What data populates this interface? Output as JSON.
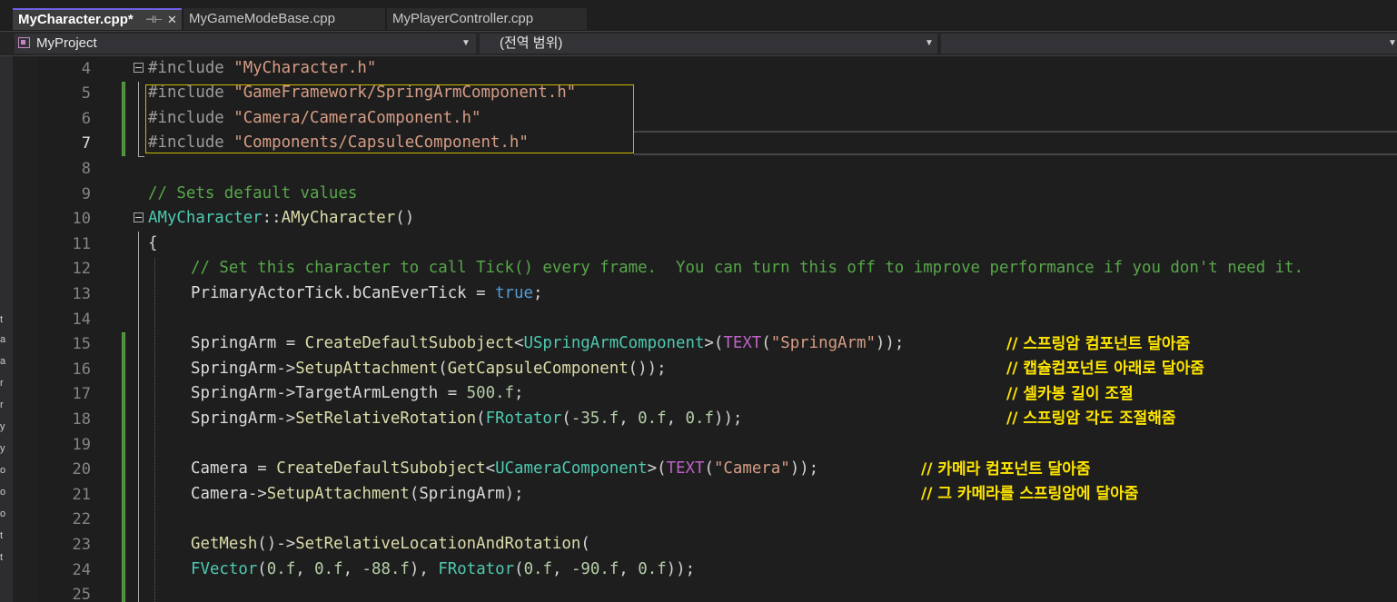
{
  "tabs": [
    {
      "label": "MyCharacter.cpp*",
      "active": true
    },
    {
      "label": "MyGameModeBase.cpp",
      "active": false
    },
    {
      "label": "MyPlayerController.cpp",
      "active": false
    }
  ],
  "nav": {
    "project": "MyProject",
    "scope": "(전역 범위)",
    "member": ""
  },
  "icons": {
    "pin": "pin-icon",
    "close": "close-icon",
    "dropdown": "chevron-down-icon",
    "fold": "collapse-icon"
  },
  "colors": {
    "active_tab_accent": "#7160e8",
    "annotation_yellow": "#ffe500",
    "change_bar_green": "#4a8a3a"
  },
  "line_numbers": [
    "4",
    "5",
    "6",
    "7",
    "8",
    "9",
    "10",
    "11",
    "12",
    "13",
    "14",
    "15",
    "16",
    "17",
    "18",
    "19",
    "20",
    "21",
    "22",
    "23",
    "24",
    "25"
  ],
  "current_line": "7",
  "code": {
    "l4": {
      "pp": "#include ",
      "str": "\"MyCharacter.h\""
    },
    "l5": {
      "pp": "#include ",
      "str": "\"GameFramework/SpringArmComponent.h\""
    },
    "l6": {
      "pp": "#include ",
      "str": "\"Camera/CameraComponent.h\""
    },
    "l7": {
      "pp": "#include ",
      "str": "\"Components/CapsuleComponent.h\""
    },
    "l9": {
      "cm": "// Sets default values"
    },
    "l10": {
      "ty": "AMyCharacter",
      "op": "::",
      "fn": "AMyCharacter",
      "rest": "()"
    },
    "l11": {
      "brace": "{"
    },
    "l12": {
      "cm": "// Set this character to call Tick() every frame.  You can turn this off to improve performance if you don't need it."
    },
    "l13": {
      "var": "PrimaryActorTick",
      "dot": ".",
      "field": "bCanEverTick",
      "eq": " = ",
      "kw": "true",
      "end": ";"
    },
    "l15": {
      "var": "SpringArm",
      "eq": " = ",
      "fn": "CreateDefaultSubobject",
      "lt": "<",
      "ty": "USpringArmComponent",
      "gt": ">(",
      "mac": "TEXT",
      "p1": "(",
      "str": "\"SpringArm\"",
      "end": "));"
    },
    "l16": {
      "var": "SpringArm",
      "arrow": "->",
      "fn": "SetupAttachment",
      "p1": "(",
      "fn2": "GetCapsuleComponent",
      "end": "());"
    },
    "l17": {
      "var": "SpringArm",
      "arrow": "->",
      "field": "TargetArmLength",
      "eq": " = ",
      "num": "500.f",
      "end": ";"
    },
    "l18": {
      "var": "SpringArm",
      "arrow": "->",
      "fn": "SetRelativeRotation",
      "p1": "(",
      "ty": "FRotator",
      "p2": "(",
      "n1": "-35.f",
      "c1": ", ",
      "n2": "0.f",
      "c2": ", ",
      "n3": "0.f",
      "end": "));"
    },
    "l20": {
      "var": "Camera",
      "eq": " = ",
      "fn": "CreateDefaultSubobject",
      "lt": "<",
      "ty": "UCameraComponent",
      "gt": ">(",
      "mac": "TEXT",
      "p1": "(",
      "str": "\"Camera\"",
      "end": "));"
    },
    "l21": {
      "var": "Camera",
      "arrow": "->",
      "fn": "SetupAttachment",
      "p1": "(",
      "var2": "SpringArm",
      "end": ");"
    },
    "l23": {
      "fn": "GetMesh",
      "p": "()",
      "arrow": "->",
      "fn2": "SetRelativeLocationAndRotation",
      "p1": "("
    },
    "l24": {
      "ty": "FVector",
      "p1": "(",
      "n1": "0.f",
      "c1": ", ",
      "n2": "0.f",
      "c2": ", ",
      "n3": "-88.f",
      "mid": "), ",
      "ty2": "FRotator",
      "p2": "(",
      "n4": "0.f",
      "c3": ", ",
      "n5": "-90.f",
      "c4": ", ",
      "n6": "0.f",
      "end": "));"
    }
  },
  "annotations": {
    "a15": "// 스프링암 컴포넌트 달아줌",
    "a16": "// 캡슐컴포넌트 아래로 달아줌",
    "a17": "// 셀카봉 길이 조절",
    "a18": "// 스프링암 각도 조절해줌",
    "a20": "// 카메라 컴포넌트 달아줌",
    "a21": "// 그 카메라를 스프링암에 달아줌"
  },
  "left_strip_chars": [
    "t",
    "a",
    "a",
    "r",
    "r",
    "y",
    "y",
    "o",
    "o",
    "o",
    "t",
    "t"
  ]
}
